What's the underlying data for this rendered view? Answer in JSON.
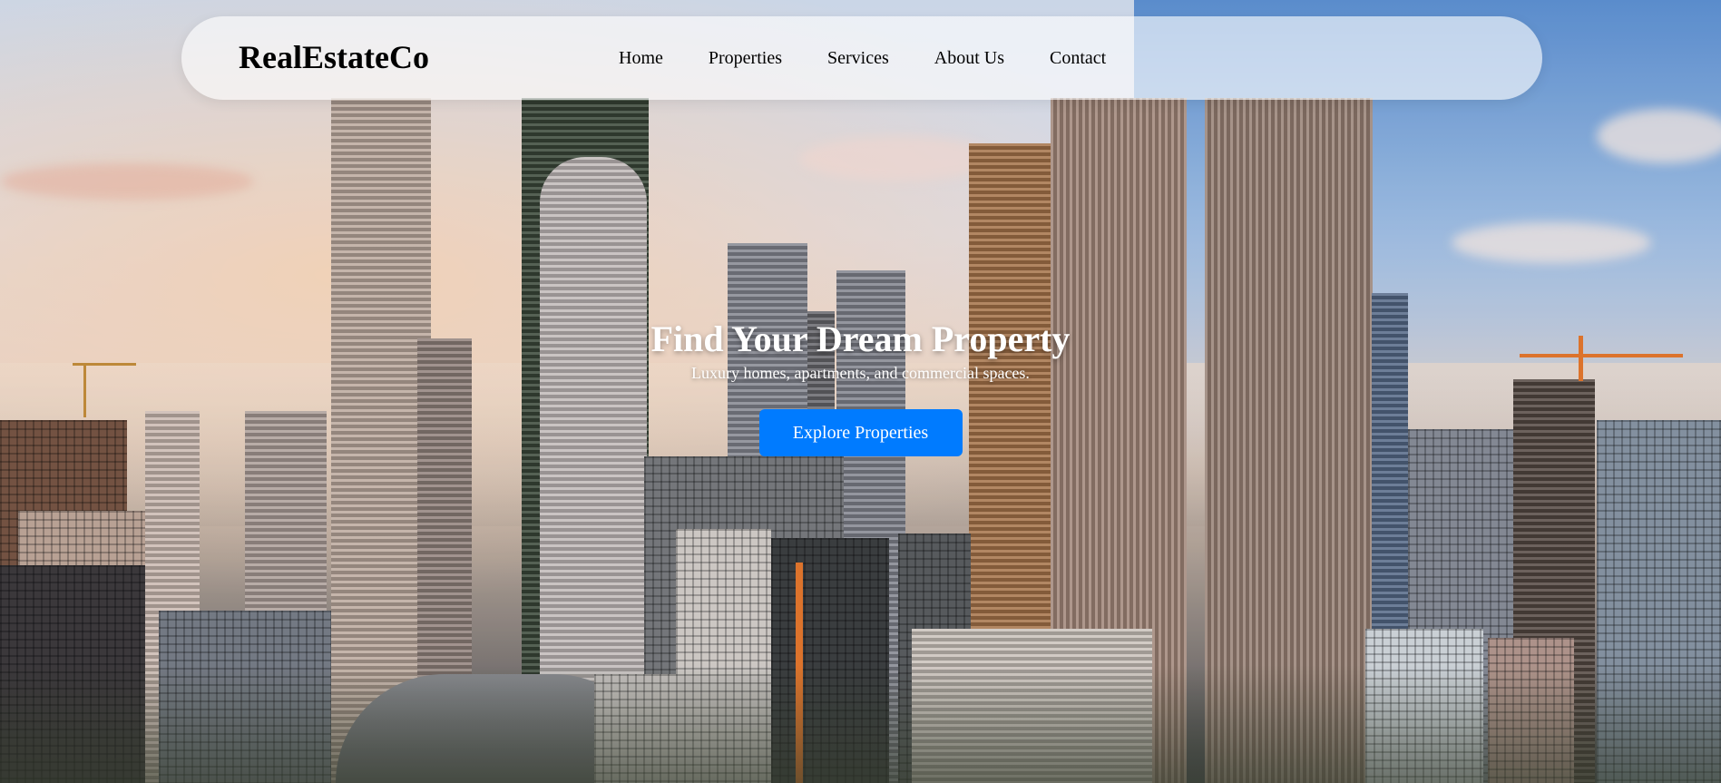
{
  "navbar": {
    "brand": "RealEstateCo",
    "links": [
      {
        "label": "Home"
      },
      {
        "label": "Properties"
      },
      {
        "label": "Services"
      },
      {
        "label": "About Us"
      },
      {
        "label": "Contact"
      }
    ]
  },
  "hero": {
    "background_image": "city-skyline-photo",
    "title": "Find Your Dream Property",
    "subtitle": "Luxury homes, apartments, and commercial spaces.",
    "cta_label": "Explore Properties"
  },
  "colors": {
    "accent": "#007bff",
    "navbar_bg": "rgba(255,255,255,0.62)",
    "hero_text": "#ffffff"
  }
}
